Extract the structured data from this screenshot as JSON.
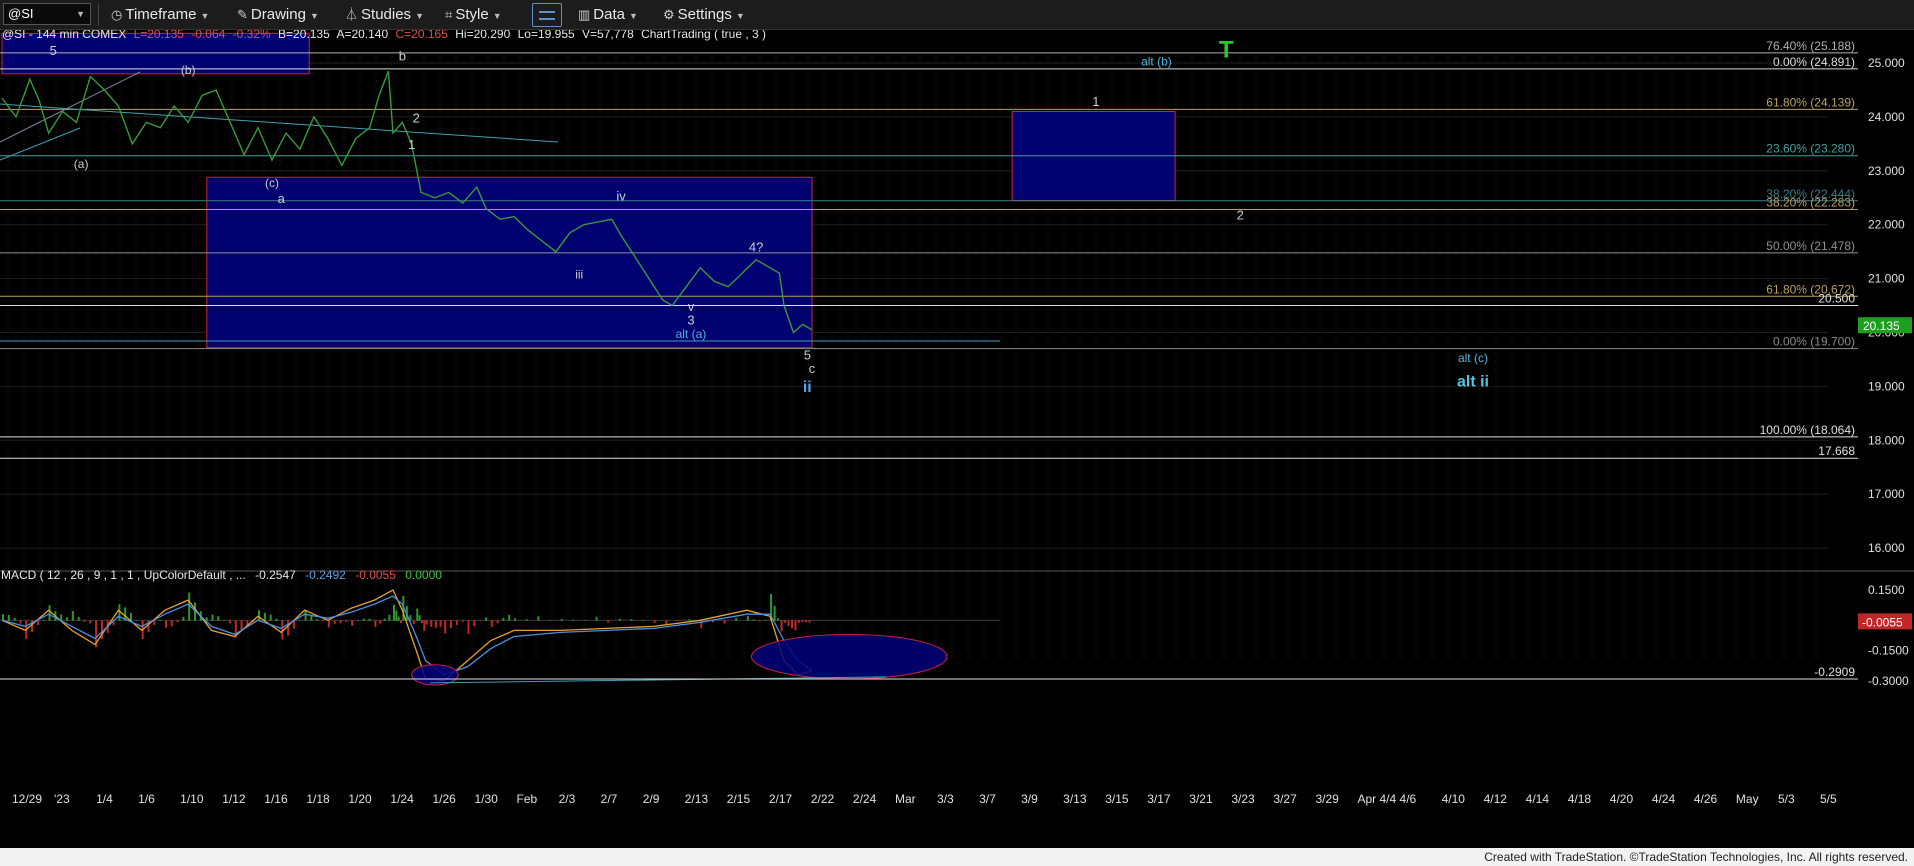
{
  "toolbar": {
    "symbol": "@SI",
    "timeframe": "Timeframe",
    "drawing": "Drawing",
    "studies": "Studies",
    "style": "Style",
    "data": "Data",
    "settings": "Settings"
  },
  "chart_data": [
    {
      "type": "candlestick",
      "header": {
        "symbol": "@SI - 144 min COMEX",
        "last": "L=20.135",
        "chg": "-0.064",
        "pct": "-0.32%",
        "bid": "B=20.135",
        "ask": "A=20.140",
        "close": "C=20.165",
        "hi": "Hi=20.290",
        "lo": "Lo=19.955",
        "vol": "V=57,778",
        "study": "ChartTrading ( true , 3 )"
      },
      "ylim": [
        15.5,
        25.3
      ],
      "yticks": [
        "25.000",
        "24.000",
        "23.000",
        "22.000",
        "21.000",
        "20.000",
        "19.000",
        "18.000",
        "17.000",
        "16.000"
      ],
      "ytick_values": [
        25,
        24,
        23,
        22,
        21,
        20,
        19,
        18,
        17,
        16
      ],
      "last_price": "20.135",
      "last_price_value": 20.135,
      "x_labels": [
        "12/29",
        "'23",
        "1/4",
        "1/6",
        "1/10",
        "1/12",
        "1/16",
        "1/18",
        "1/20",
        "1/24",
        "1/26",
        "1/30",
        "Feb",
        "2/3",
        "2/7",
        "2/9",
        "2/13",
        "2/15",
        "2/17",
        "2/22",
        "2/24",
        "Mar",
        "3/3",
        "3/7",
        "3/9",
        "3/13",
        "3/15",
        "3/17",
        "3/21",
        "3/23",
        "3/27",
        "3/29",
        "Apr 4/4",
        "4/6",
        "4/10",
        "4/12",
        "4/14",
        "4/18",
        "4/20",
        "4/24",
        "4/26",
        "May",
        "5/3",
        "5/5"
      ],
      "price_path": [
        [
          0,
          24.35
        ],
        [
          3,
          24.0
        ],
        [
          6,
          24.7
        ],
        [
          8,
          24.3
        ],
        [
          10,
          23.7
        ],
        [
          13,
          24.1
        ],
        [
          16,
          23.9
        ],
        [
          19,
          24.75
        ],
        [
          22,
          24.5
        ],
        [
          25,
          24.2
        ],
        [
          28,
          23.5
        ],
        [
          31,
          23.9
        ],
        [
          34,
          23.8
        ],
        [
          37,
          24.2
        ],
        [
          40,
          23.9
        ],
        [
          43,
          24.4
        ],
        [
          46,
          24.5
        ],
        [
          49,
          23.9
        ],
        [
          52,
          23.3
        ],
        [
          55,
          23.8
        ],
        [
          58,
          23.2
        ],
        [
          61,
          23.7
        ],
        [
          64,
          23.4
        ],
        [
          67,
          24.0
        ],
        [
          70,
          23.6
        ],
        [
          73,
          23.1
        ],
        [
          76,
          23.6
        ],
        [
          79,
          23.8
        ],
        [
          81,
          24.4
        ],
        [
          83,
          24.85
        ],
        [
          84,
          23.7
        ],
        [
          86,
          23.9
        ],
        [
          88,
          23.5
        ],
        [
          90,
          22.6
        ],
        [
          93,
          22.5
        ],
        [
          96,
          22.6
        ],
        [
          99,
          22.4
        ],
        [
          102,
          22.7
        ],
        [
          104,
          22.3
        ],
        [
          107,
          22.1
        ],
        [
          110,
          22.15
        ],
        [
          113,
          21.9
        ],
        [
          116,
          21.7
        ],
        [
          119,
          21.5
        ],
        [
          122,
          21.85
        ],
        [
          125,
          22.0
        ],
        [
          128,
          22.05
        ],
        [
          131,
          22.1
        ],
        [
          133,
          21.8
        ],
        [
          136,
          21.4
        ],
        [
          139,
          21.0
        ],
        [
          142,
          20.6
        ],
        [
          144,
          20.5
        ],
        [
          147,
          20.85
        ],
        [
          150,
          21.2
        ],
        [
          153,
          20.95
        ],
        [
          156,
          20.85
        ],
        [
          159,
          21.1
        ],
        [
          162,
          21.35
        ],
        [
          165,
          21.2
        ],
        [
          167,
          21.1
        ],
        [
          168,
          20.5
        ],
        [
          170,
          20.0
        ],
        [
          172,
          20.15
        ],
        [
          174,
          20.05
        ]
      ],
      "fib_lines": [
        {
          "label": "76.40% (25.188)",
          "value": 25.188,
          "color": "#b0b0b0"
        },
        {
          "label": "0.00% (24.891)",
          "value": 24.891,
          "color": "#dddddd"
        },
        {
          "label": "61.80% (24.139)",
          "value": 24.139,
          "color": "#b8a060"
        },
        {
          "label": "23.60% (23.280)",
          "value": 23.28,
          "color": "#40a0a0"
        },
        {
          "label": "38.20% (22.444)",
          "value": 22.444,
          "color": "#3a7d85"
        },
        {
          "label": "38.20% (22.283)",
          "value": 22.283,
          "color": "#b8a060"
        },
        {
          "label": "50.00% (21.478)",
          "value": 21.478,
          "color": "#909090"
        },
        {
          "label": "61.80% (20.672)",
          "value": 20.672,
          "color": "#b8a060"
        },
        {
          "label": "20.500",
          "value": 20.5,
          "color": "#e0e0e0"
        },
        {
          "label": "0.00% (19.700)",
          "value": 19.7,
          "color": "#8a8a8a"
        },
        {
          "label": "100.00% (18.064)",
          "value": 18.064,
          "color": "#e0e0e0"
        },
        {
          "label": "17.668",
          "value": 17.668,
          "color": "#e0e0e0"
        }
      ],
      "boxes": [
        {
          "x0": 0,
          "x1": 66,
          "y0": 24.8,
          "y1": 25.55
        },
        {
          "x0": 44,
          "x1": 174,
          "y0": 19.72,
          "y1": 22.88
        },
        {
          "x0": 217,
          "x1": 252,
          "y0": 22.45,
          "y1": 24.1
        }
      ],
      "wave_labels": [
        {
          "text": "5",
          "x": 11,
          "y": 25.15,
          "color": "#cccccc"
        },
        {
          "text": "(b)",
          "x": 40,
          "y": 24.8,
          "color": "#cccccc"
        },
        {
          "text": "b",
          "x": 86,
          "y": 25.05,
          "color": "#cccccc"
        },
        {
          "text": "(a)",
          "x": 17,
          "y": 23.05,
          "color": "#cccccc"
        },
        {
          "text": "2",
          "x": 89,
          "y": 23.9,
          "color": "#cccccc"
        },
        {
          "text": "1",
          "x": 88,
          "y": 23.4,
          "color": "#cccccc"
        },
        {
          "text": "(c)",
          "x": 58,
          "y": 22.7,
          "color": "#cccccc"
        },
        {
          "text": "a",
          "x": 60,
          "y": 22.4,
          "color": "#cccccc"
        },
        {
          "text": "iv",
          "x": 133,
          "y": 22.45,
          "color": "#cccccc"
        },
        {
          "text": "iii",
          "x": 124,
          "y": 21.0,
          "color": "#cccccc"
        },
        {
          "text": "4?",
          "x": 162,
          "y": 21.5,
          "color": "#cccccc"
        },
        {
          "text": "v",
          "x": 148,
          "y": 20.4,
          "color": "#cccccc"
        },
        {
          "text": "3",
          "x": 148,
          "y": 20.15,
          "color": "#cccccc"
        },
        {
          "text": "alt (a)",
          "x": 148,
          "y": 19.9,
          "color": "#4fb5d8"
        },
        {
          "text": "5",
          "x": 173,
          "y": 19.5,
          "color": "#cccccc"
        },
        {
          "text": "c",
          "x": 174,
          "y": 19.25,
          "color": "#cccccc"
        },
        {
          "text": "ii",
          "x": 173,
          "y": 18.9,
          "color": "#5aa0e0"
        },
        {
          "text": "1",
          "x": 235,
          "y": 24.2,
          "color": "#cccccc"
        },
        {
          "text": "alt (b)",
          "x": 248,
          "y": 24.95,
          "color": "#4fb5d8"
        },
        {
          "text": "2",
          "x": 266,
          "y": 22.1,
          "color": "#cccccc"
        },
        {
          "text": "alt (c)",
          "x": 316,
          "y": 19.45,
          "color": "#4fb5d8"
        },
        {
          "text": "alt ii",
          "x": 316,
          "y": 19.0,
          "color": "#4fc8e0"
        }
      ],
      "marker": {
        "text": "T",
        "x": 263,
        "y": 25.25,
        "color": "#22cc22"
      }
    },
    {
      "type": "line",
      "title": "MACD ( 12 , 26 , 9 , 1 , 1 , UpColorDefault , ...",
      "values_text": [
        "-0.2547",
        "-0.2492",
        "-0.0055",
        "0.0000"
      ],
      "values_colors": [
        "#e8e8e8",
        "#5aa0e0",
        "#e05050",
        "#40c040"
      ],
      "ylim": [
        -0.34,
        0.2
      ],
      "yticks": [
        "0.1500",
        "-0.1500",
        "-0.3000"
      ],
      "ytick_values": [
        0.15,
        -0.15,
        -0.3
      ],
      "last_value": "-0.0055",
      "last_value_num": -0.0055,
      "level_line": {
        "label": "-0.2909",
        "value": -0.2909
      },
      "macd": [
        [
          0,
          0
        ],
        [
          5,
          -0.05
        ],
        [
          10,
          0.05
        ],
        [
          15,
          -0.05
        ],
        [
          20,
          -0.12
        ],
        [
          25,
          0.05
        ],
        [
          30,
          -0.05
        ],
        [
          35,
          0.05
        ],
        [
          40,
          0.1
        ],
        [
          45,
          -0.05
        ],
        [
          50,
          -0.08
        ],
        [
          55,
          0.02
        ],
        [
          60,
          -0.06
        ],
        [
          65,
          0.05
        ],
        [
          70,
          0.0
        ],
        [
          75,
          0.06
        ],
        [
          80,
          0.1
        ],
        [
          84,
          0.15
        ],
        [
          86,
          0.05
        ],
        [
          89,
          -0.15
        ],
        [
          91,
          -0.29
        ],
        [
          95,
          -0.3
        ],
        [
          100,
          -0.2
        ],
        [
          105,
          -0.1
        ],
        [
          110,
          -0.05
        ],
        [
          120,
          -0.05
        ],
        [
          130,
          -0.04
        ],
        [
          140,
          -0.03
        ],
        [
          150,
          0.0
        ],
        [
          160,
          0.05
        ],
        [
          165,
          0.02
        ],
        [
          168,
          -0.2
        ],
        [
          171,
          -0.27
        ],
        [
          174,
          -0.25
        ]
      ],
      "signal": [
        [
          0,
          0
        ],
        [
          5,
          -0.03
        ],
        [
          10,
          0.03
        ],
        [
          15,
          -0.03
        ],
        [
          20,
          -0.09
        ],
        [
          25,
          0.02
        ],
        [
          30,
          -0.03
        ],
        [
          35,
          0.03
        ],
        [
          40,
          0.08
        ],
        [
          45,
          -0.03
        ],
        [
          50,
          -0.07
        ],
        [
          55,
          0.0
        ],
        [
          60,
          -0.04
        ],
        [
          65,
          0.03
        ],
        [
          70,
          0.01
        ],
        [
          75,
          0.04
        ],
        [
          80,
          0.08
        ],
        [
          84,
          0.12
        ],
        [
          86,
          0.08
        ],
        [
          89,
          -0.08
        ],
        [
          91,
          -0.2
        ],
        [
          95,
          -0.27
        ],
        [
          100,
          -0.23
        ],
        [
          105,
          -0.14
        ],
        [
          110,
          -0.08
        ],
        [
          120,
          -0.06
        ],
        [
          130,
          -0.05
        ],
        [
          140,
          -0.04
        ],
        [
          150,
          -0.01
        ],
        [
          160,
          0.03
        ],
        [
          165,
          0.03
        ],
        [
          168,
          -0.1
        ],
        [
          171,
          -0.2
        ],
        [
          174,
          -0.25
        ]
      ],
      "ellipses": [
        {
          "cx": 93,
          "cy": -0.27,
          "rx": 5,
          "ry": 0.05
        },
        {
          "cx": 182,
          "cy": -0.18,
          "rx": 21,
          "ry": 0.11
        }
      ]
    }
  ],
  "footer": "Created with TradeStation. ©TradeStation Technologies, Inc. All rights reserved."
}
